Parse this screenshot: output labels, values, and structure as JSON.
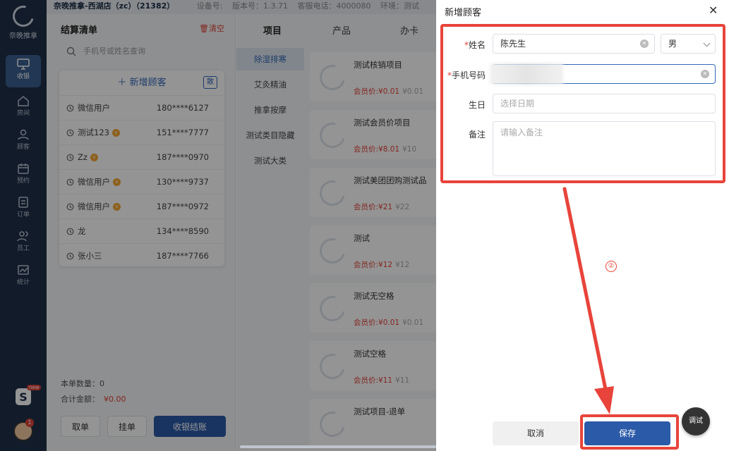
{
  "app": {
    "logo_text": "奈晚推拿",
    "store": "奈晚推拿-西湖店（zc）（21382）",
    "meta": [
      "设备号:",
      "版本号：1.3.71",
      "客服电话：4000080",
      "环境：测试"
    ]
  },
  "nav": {
    "items": [
      {
        "label": "收银",
        "icon": "cashier-icon",
        "active": true
      },
      {
        "label": "房间",
        "icon": "home-icon"
      },
      {
        "label": "顾客",
        "icon": "user-icon"
      },
      {
        "label": "预约",
        "icon": "calendar-icon"
      },
      {
        "label": "订单",
        "icon": "order-icon"
      },
      {
        "label": "员工",
        "icon": "staff-icon"
      },
      {
        "label": "统计",
        "icon": "chart-icon"
      }
    ],
    "new_badge": "new",
    "avatar_badge": "1"
  },
  "checkout": {
    "title": "结算清单",
    "clear_label": "清空",
    "search_placeholder": "手机号或姓名查询",
    "add_customer_label": "新增顾客",
    "scatter_label": "散",
    "customers": [
      {
        "name": "微信用户",
        "phone": "180****6127",
        "vip": false
      },
      {
        "name": "测试123",
        "phone": "151****7777",
        "vip": true
      },
      {
        "name": "Zz",
        "phone": "187****0970",
        "vip": true
      },
      {
        "name": "微信用户",
        "phone": "130****9737",
        "vip": true
      },
      {
        "name": "微信用户",
        "phone": "187****0972",
        "vip": true
      },
      {
        "name": "龙",
        "phone": "134****8590",
        "vip": false
      },
      {
        "name": "张小三",
        "phone": "187****7766",
        "vip": false
      }
    ],
    "count_label": "本单数量：",
    "count_value": "0",
    "total_label": "合计金额：",
    "total_value": "¥0.00",
    "btn_take": "取单",
    "btn_hold": "挂单",
    "btn_settle": "收银结账"
  },
  "product_tabs": [
    "项目",
    "产品",
    "办卡"
  ],
  "categories": [
    "除湿排寒",
    "艾灸精油",
    "推拿按摩",
    "测试类目隐藏",
    "测试大类"
  ],
  "products": [
    {
      "name": "测试核销项目",
      "member_price": "会员价:¥0.01",
      "price": "¥0.01"
    },
    {
      "name": "测试会员价项目",
      "member_price": "会员价:¥8.01",
      "price": "¥10"
    },
    {
      "name": "测试美团团购测试品",
      "member_price": "会员价:¥21",
      "price": "¥22"
    },
    {
      "name": "测试",
      "member_price": "会员价:¥12",
      "price": "¥12"
    },
    {
      "name": "测试无空格",
      "member_price": "会员价:¥0.01",
      "price": "¥0.01"
    },
    {
      "name": "测试空格",
      "member_price": "会员价:¥11",
      "price": "¥11"
    },
    {
      "name": "测试项目-退单",
      "member_price": "",
      "price": ""
    }
  ],
  "drawer": {
    "title": "新增顾客",
    "name_label": "姓名",
    "name_value": "陈先生",
    "gender_value": "男",
    "phone_label": "手机号码",
    "birthday_label": "生日",
    "birthday_placeholder": "选择日期",
    "note_label": "备注",
    "note_placeholder": "请输入备注",
    "cancel_label": "取消",
    "save_label": "保存",
    "debug_label": "调试",
    "step_marker": "②"
  },
  "colors": {
    "accent": "#2b5aa8",
    "annotation": "#e8443b",
    "nav_bg": "#1e2f48"
  }
}
